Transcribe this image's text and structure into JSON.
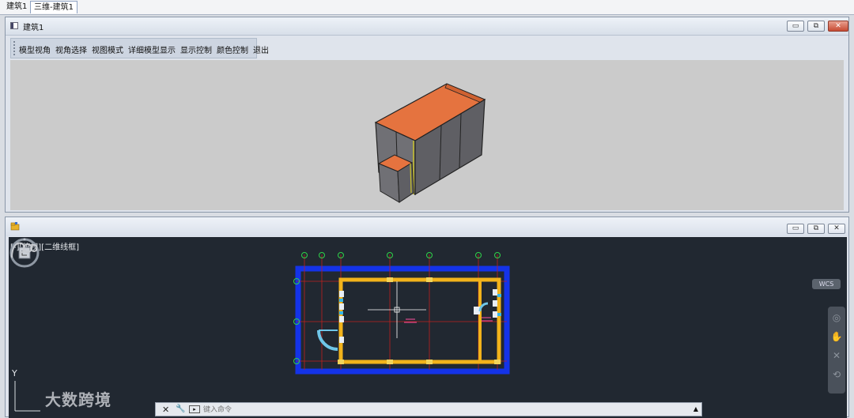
{
  "doc_tabs": [
    "建筑1",
    "三维-建筑1"
  ],
  "window3d": {
    "title": "建筑1",
    "menu": [
      "模型视角",
      "视角选择",
      "视图模式",
      "详细模型显示",
      "显示控制",
      "颜色控制",
      "退出"
    ]
  },
  "cad": {
    "view_label": "[-][俯视][二维线框]",
    "wcs_label": "WCS",
    "axis_label": "Y",
    "command_placeholder": "键入命令"
  },
  "watermark": "大数跨境",
  "colors": {
    "roof": "#e5733f",
    "wall": "#6f6f74",
    "canvas_bg": "#212831",
    "plan_wall": "#f2b31b",
    "plan_outline": "#1433e8",
    "axis_grid": "#c0201e",
    "axis_bubble": "#2fd24a",
    "door": "#6fc6e8"
  },
  "icons": {
    "window_icon": "window-icon",
    "folder_icon": "folder-icon",
    "close": "close-icon",
    "wrench": "wrench-icon"
  }
}
